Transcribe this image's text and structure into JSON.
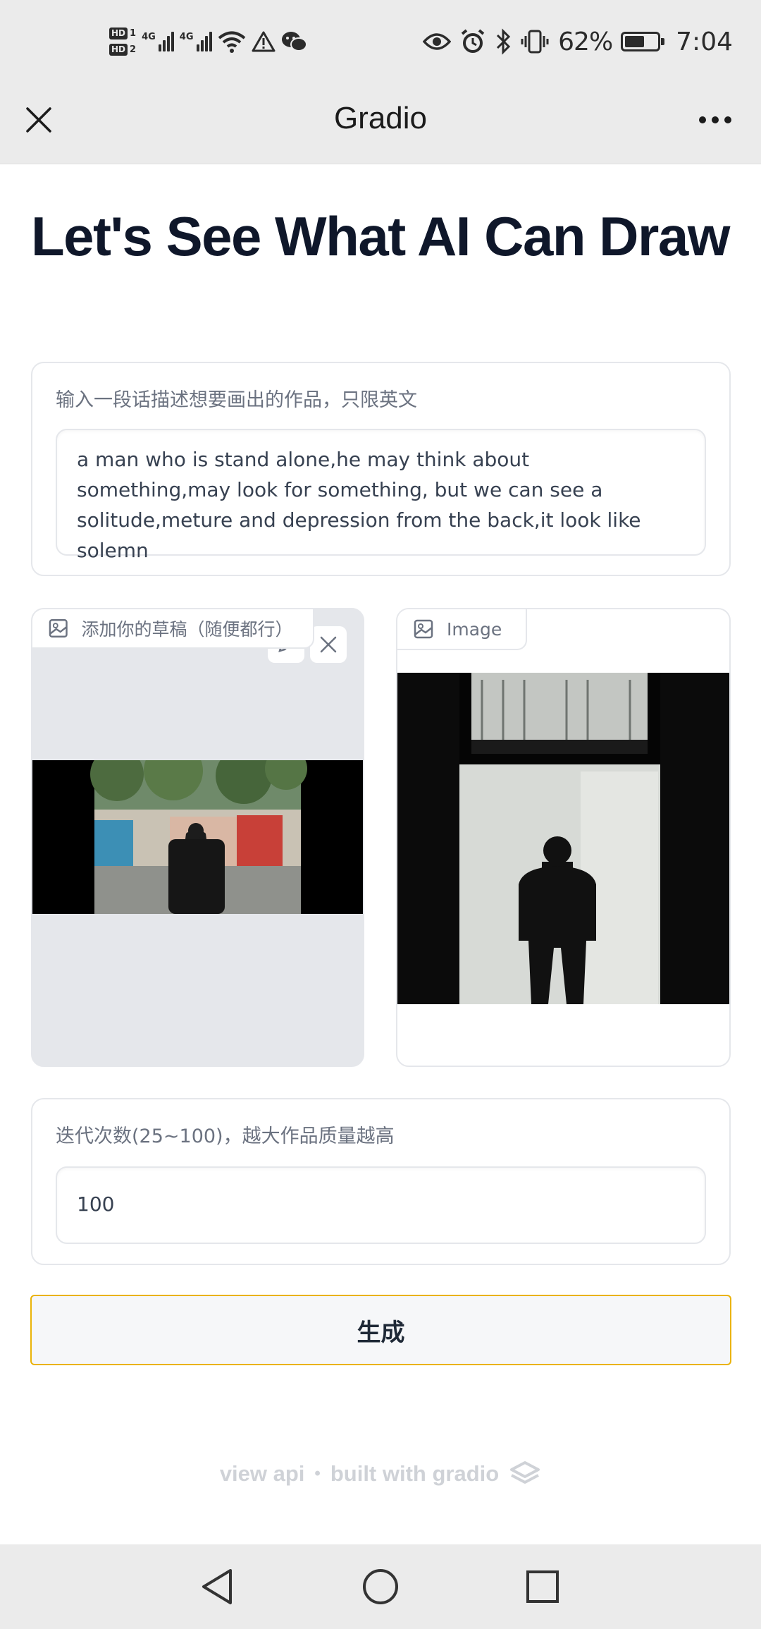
{
  "status_bar": {
    "sim1": "1",
    "sim2": "2",
    "hd": "HD",
    "net_label": "4G",
    "battery_percent": "62%",
    "battery_level": 0.62,
    "time": "7:04",
    "icons": [
      "sim-hd-icon",
      "signal-icon",
      "wifi-icon",
      "warning-icon",
      "wechat-icon",
      "eye-icon",
      "alarm-icon",
      "bluetooth-icon",
      "vibrate-icon",
      "battery-icon"
    ]
  },
  "title_bar": {
    "title": "Gradio",
    "close_icon": "close-icon",
    "more_icon": "more-horizontal-icon"
  },
  "page": {
    "title": "Let's See What AI Can Draw"
  },
  "prompt": {
    "label": "输入一段话描述想要画出的作品，只限英文",
    "value": "a man who is stand alone,he may think about something,may look for something, but we can see a solitude,meture and depression from the back,it look like solemn"
  },
  "sketch": {
    "label": "添加你的草稿（随便都行）",
    "icon": "image-icon"
  },
  "output": {
    "label": "Image",
    "icon": "image-icon"
  },
  "steps": {
    "label": "迭代次数(25~100)，越大作品质量越高",
    "value": "100"
  },
  "generate_button": {
    "label": "生成",
    "border_color": "#eab308"
  },
  "footer": {
    "api_link": "view api",
    "separator": "•",
    "built_with": "built with gradio"
  },
  "nav_bar": {
    "icons": [
      "back-triangle-icon",
      "home-circle-icon",
      "recents-square-icon"
    ]
  }
}
